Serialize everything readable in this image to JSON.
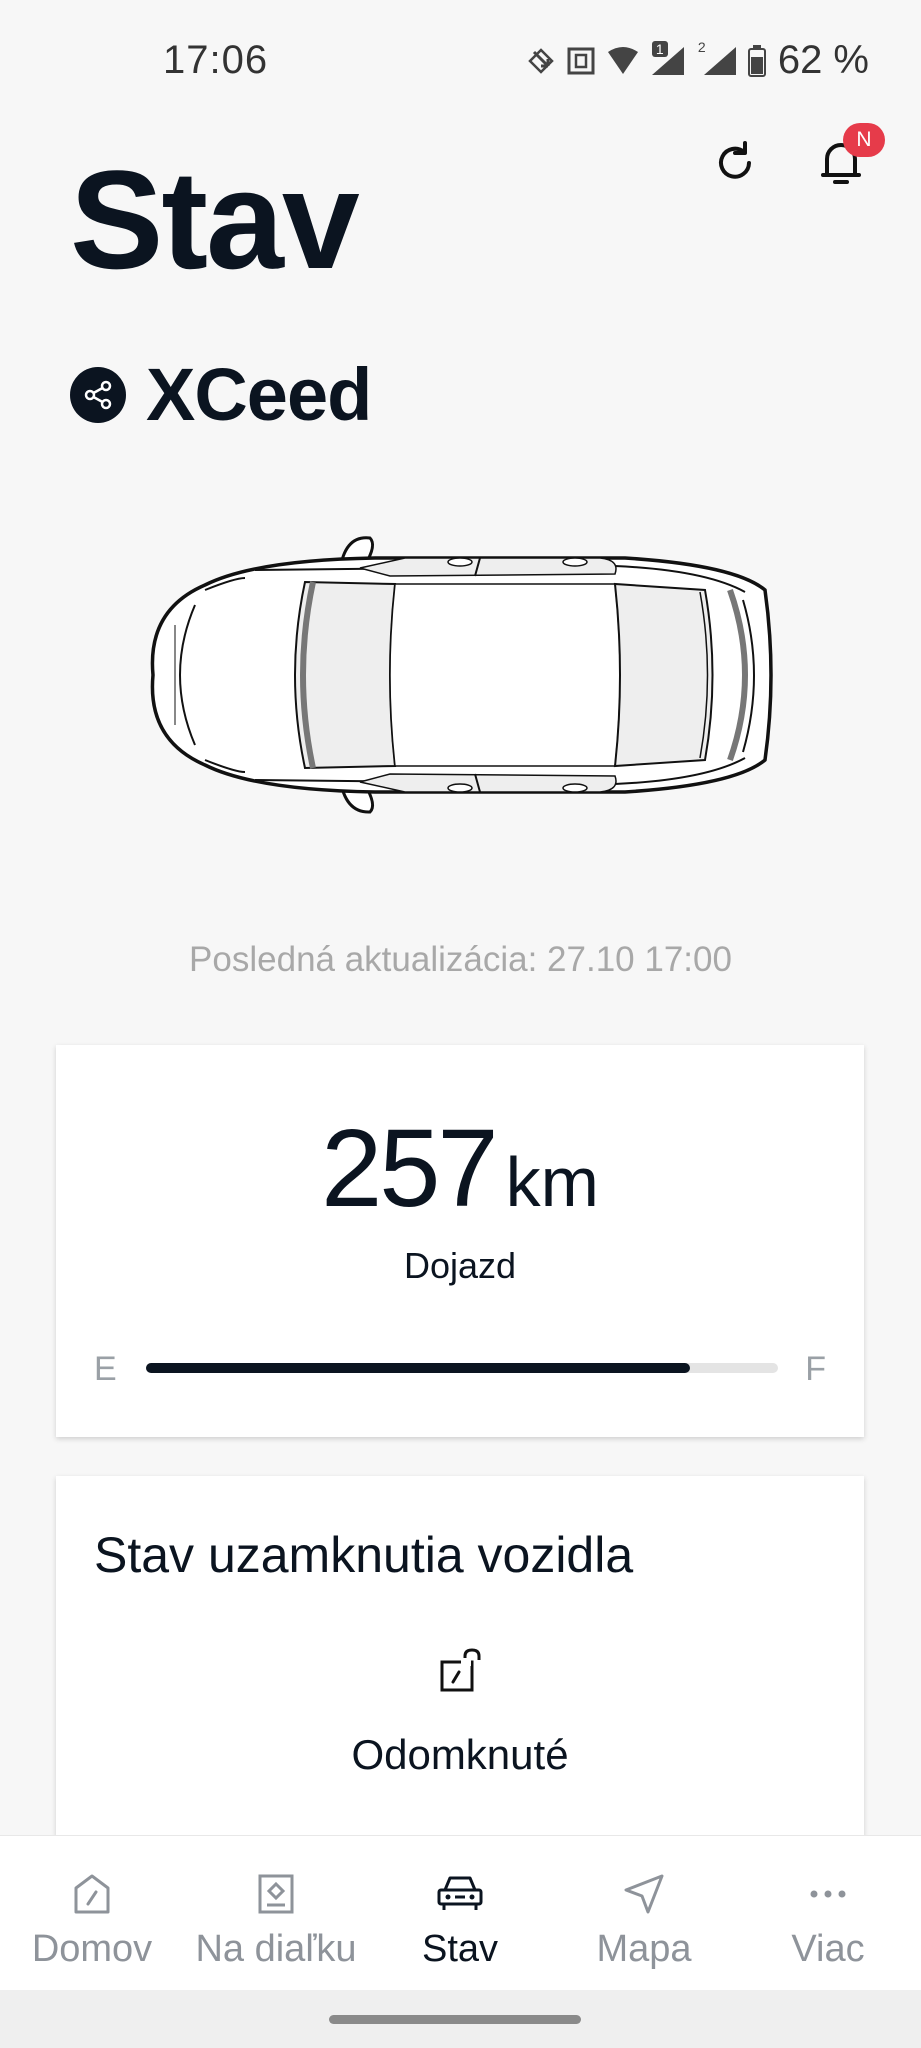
{
  "status_bar": {
    "time": "17:06",
    "battery_percent": "62 %",
    "sim1_badge": "1",
    "sim2_badge": "2"
  },
  "header": {
    "title": "Stav",
    "notification_badge": "N",
    "icons": [
      "refresh-icon",
      "bell-icon"
    ]
  },
  "vehicle": {
    "name": "XCeed",
    "share_icon": "share-icon"
  },
  "last_update": "Posledná aktualizácia: 27.10 17:00",
  "range": {
    "value": "257",
    "unit": "km",
    "label": "Dojazd",
    "gauge_empty": "E",
    "gauge_full": "F",
    "fuel_level_percent": 86
  },
  "lock_status": {
    "title": "Stav uzamknutia vozidla",
    "state": "Odomknuté",
    "icon": "unlocked-icon"
  },
  "bottom_nav": {
    "items": [
      {
        "label": "Domov",
        "icon": "home-icon",
        "active": false
      },
      {
        "label": "Na diaľku",
        "icon": "remote-icon",
        "active": false
      },
      {
        "label": "Stav",
        "icon": "car-icon",
        "active": true
      },
      {
        "label": "Mapa",
        "icon": "map-arrow-icon",
        "active": false
      },
      {
        "label": "Viac",
        "icon": "more-icon",
        "active": false
      }
    ]
  },
  "colors": {
    "primary_dark": "#0b1420",
    "background": "#f7f7f7",
    "badge_red": "#e63b4a",
    "muted_text": "#a8a8a8"
  }
}
